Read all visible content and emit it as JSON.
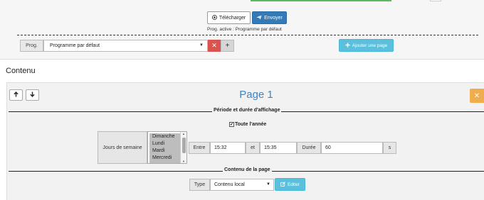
{
  "toolbar": {
    "download_label": "Télécharger",
    "send_label": "Envoyer",
    "active_program": "Prog. active : Programme par défaut"
  },
  "program": {
    "label": "Prog.",
    "selected": "Programme par défaut",
    "delete_symbol": "✕",
    "add_symbol": "+",
    "add_page_label": "Ajouter une page"
  },
  "content_heading": "Contenu",
  "page": {
    "title": "Page 1",
    "period_section_title": "Période et durée d'affichage",
    "all_year_label": "Toute l'année",
    "all_year_checked": true,
    "weekdays_label": "Jours de semaine",
    "weekdays": [
      "Dimanche",
      "Lundi",
      "Mardi",
      "Mercredi"
    ],
    "between_label": "Entre",
    "start_time": "15:32",
    "and_label": "et",
    "end_time": "15:35",
    "duration_label": "Durée",
    "duration_value": "60",
    "duration_unit": "s",
    "content_section_title": "Contenu de la page",
    "type_label": "Type",
    "type_value": "Contenu local",
    "edit_label": "Editer"
  },
  "colors": {
    "primary": "#337ab7",
    "info": "#5bc0de",
    "danger": "#d9534f",
    "warning": "#f0ad4e",
    "title_blue": "#3a84c5"
  },
  "icons": {
    "download": "download-circle-icon",
    "send": "paper-plane-icon",
    "add_page": "plus-icon",
    "move_up": "arrow-up-icon",
    "move_down": "arrow-down-icon",
    "close": "close-icon",
    "edit": "edit-icon"
  }
}
